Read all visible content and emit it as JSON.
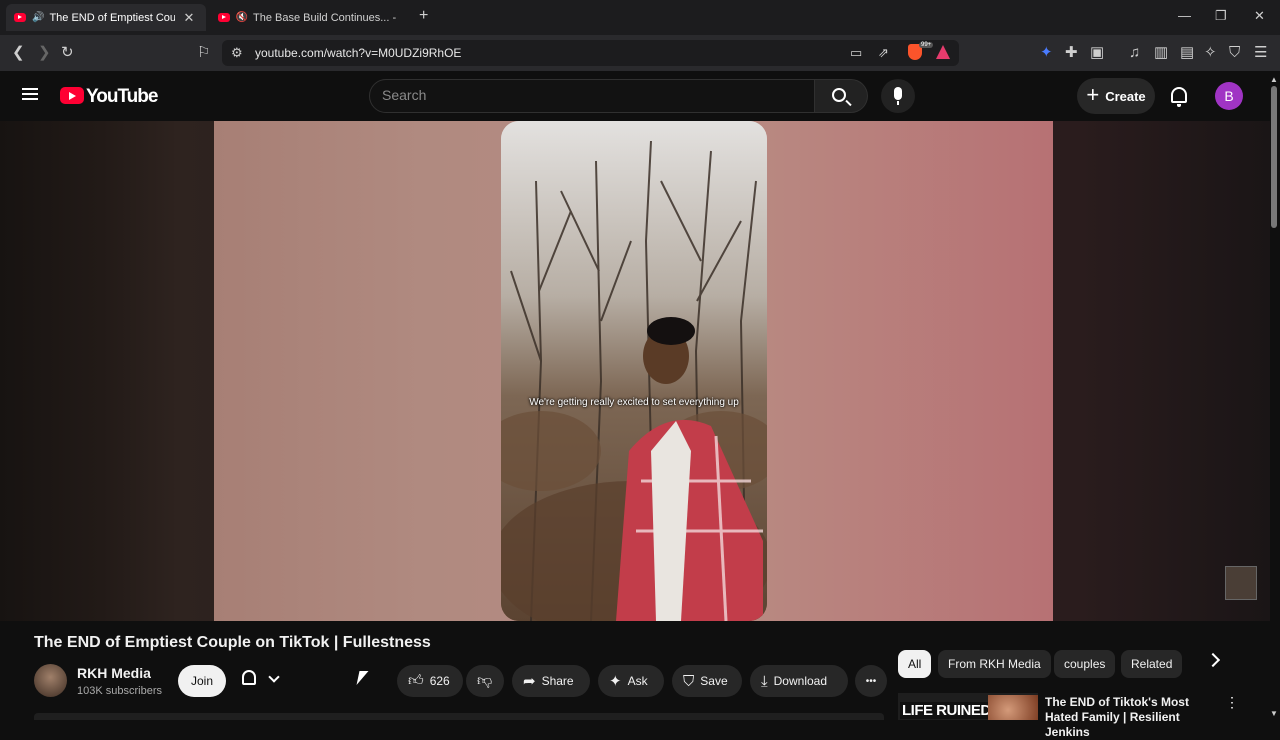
{
  "browser": {
    "tabs": [
      {
        "title": "The END of Emptiest Couple",
        "audio": "🔊"
      },
      {
        "title": "The Base Build Continues... - You",
        "audio": "🔇"
      }
    ],
    "new_tab_icon": "+",
    "window_controls": {
      "minimize": "—",
      "restore": "❐",
      "close": "✕"
    },
    "url": "youtube.com/watch?v=M0UDZi9RhOE",
    "shield_badge": "99+"
  },
  "header": {
    "logo_text": "YouTube",
    "search_placeholder": "Search",
    "create_label": "Create",
    "avatar_letter": "B"
  },
  "video": {
    "caption": "We're getting really excited to set everything up",
    "title": "The END of Emptiest Couple on TikTok | Fullestness"
  },
  "channel": {
    "name": "RKH Media",
    "subscribers": "103K subscribers",
    "join_label": "Join"
  },
  "actions": {
    "like_count": "626",
    "share_label": "Share",
    "ask_label": "Ask",
    "save_label": "Save",
    "download_label": "Download",
    "more": "•••"
  },
  "chips": [
    "All",
    "From RKH Media",
    "couples",
    "Related"
  ],
  "recommendation": {
    "thumb_text": "LIFE RUINED",
    "title": "The END of Tiktok's Most Hated Family | Resilient Jenkins"
  },
  "colors": {
    "yt_red": "#ff0033",
    "avatar_purple": "#a034c4",
    "background": "#0f0f0f"
  }
}
